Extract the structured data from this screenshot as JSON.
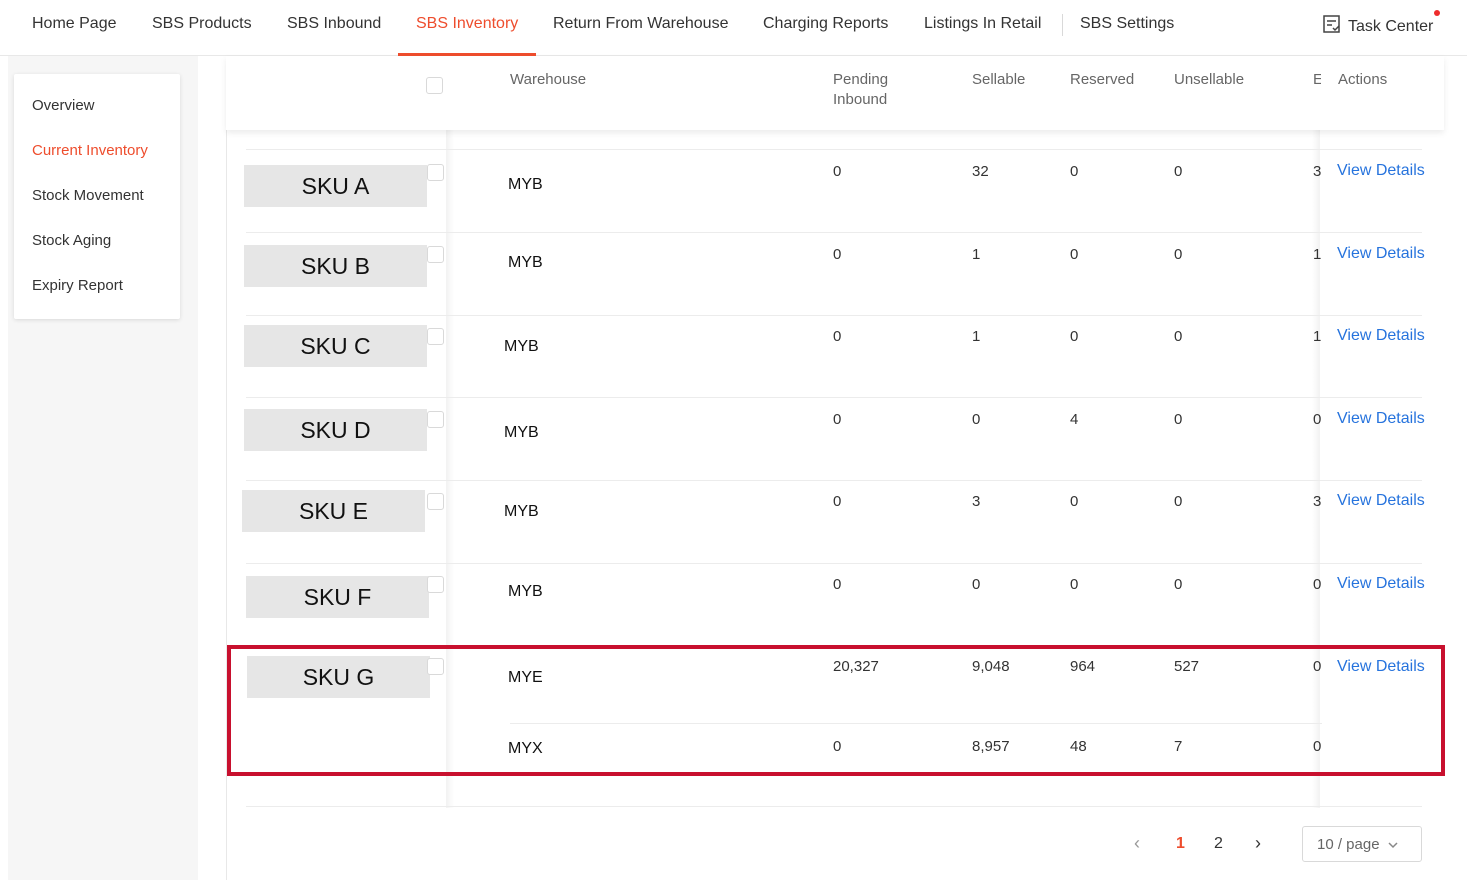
{
  "topnav": {
    "items": [
      {
        "label": "Home Page",
        "active": false
      },
      {
        "label": "SBS Products",
        "active": false
      },
      {
        "label": "SBS Inbound",
        "active": false
      },
      {
        "label": "SBS Inventory",
        "active": true
      },
      {
        "label": "Return From Warehouse",
        "active": false
      },
      {
        "label": "Charging Reports",
        "active": false
      },
      {
        "label": "Listings In Retail",
        "active": false
      },
      {
        "label": "SBS Settings",
        "active": false
      }
    ],
    "task_center": "Task Center"
  },
  "sidebar": {
    "items": [
      {
        "label": "Overview",
        "active": false
      },
      {
        "label": "Current Inventory",
        "active": true
      },
      {
        "label": "Stock Movement",
        "active": false
      },
      {
        "label": "Stock Aging",
        "active": false
      },
      {
        "label": "Expiry Report",
        "active": false
      }
    ]
  },
  "table": {
    "headers": {
      "warehouse": "Warehouse",
      "pending_1": "Pending",
      "pending_2": "Inbound",
      "sellable": "Sellable",
      "reserved": "Reserved",
      "unsellable": "Unsellable",
      "clipped": "E",
      "actions": "Actions"
    },
    "rows": [
      {
        "sku": "SKU A",
        "warehouse": "MYB",
        "pending": "0",
        "sellable": "32",
        "reserved": "0",
        "unsellable": "0",
        "clipped": "3",
        "action": "View Details"
      },
      {
        "sku": "SKU B",
        "warehouse": "MYB",
        "pending": "0",
        "sellable": "1",
        "reserved": "0",
        "unsellable": "0",
        "clipped": "1",
        "action": "View Details"
      },
      {
        "sku": "SKU C",
        "warehouse": "MYB",
        "pending": "0",
        "sellable": "1",
        "reserved": "0",
        "unsellable": "0",
        "clipped": "1",
        "action": "View Details"
      },
      {
        "sku": "SKU D",
        "warehouse": "MYB",
        "pending": "0",
        "sellable": "0",
        "reserved": "4",
        "unsellable": "0",
        "clipped": "0",
        "action": "View Details"
      },
      {
        "sku": "SKU E",
        "warehouse": "MYB",
        "pending": "0",
        "sellable": "3",
        "reserved": "0",
        "unsellable": "0",
        "clipped": "3",
        "action": "View Details"
      },
      {
        "sku": "SKU F",
        "warehouse": "MYB",
        "pending": "0",
        "sellable": "0",
        "reserved": "0",
        "unsellable": "0",
        "clipped": "0",
        "action": "View Details"
      }
    ],
    "row_g": {
      "sku": "SKU G",
      "action": "View Details",
      "sub": [
        {
          "warehouse": "MYE",
          "pending": "20,327",
          "sellable": "9,048",
          "reserved": "964",
          "unsellable": "527",
          "clipped": "0"
        },
        {
          "warehouse": "MYX",
          "pending": "0",
          "sellable": "8,957",
          "reserved": "48",
          "unsellable": "7",
          "clipped": "0"
        }
      ]
    }
  },
  "pagination": {
    "pages": [
      "1",
      "2"
    ],
    "current": "1",
    "page_size": "10 / page"
  },
  "colors": {
    "accent": "#ee4d2d",
    "link": "#2673dd",
    "highlight": "#c8102e"
  }
}
